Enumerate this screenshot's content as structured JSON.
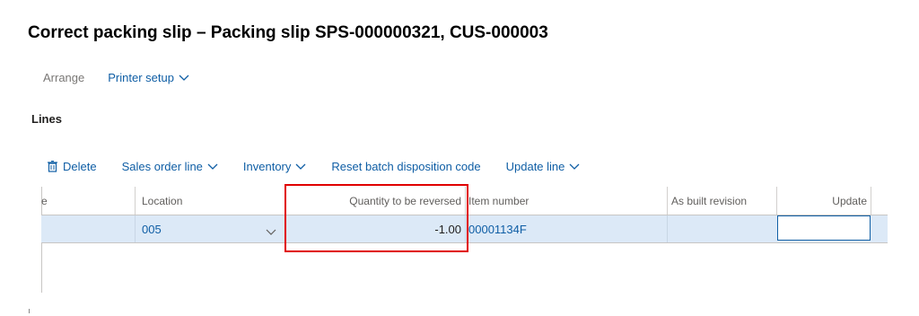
{
  "page": {
    "title": "Correct packing slip – Packing slip SPS-000000321, CUS-000003"
  },
  "toolbar": {
    "arrange_label": "Arrange",
    "printer_setup_label": "Printer setup"
  },
  "lines_section": {
    "label": "Lines"
  },
  "lines_toolbar": {
    "delete_label": "Delete",
    "sales_order_line_label": "Sales order line",
    "inventory_label": "Inventory",
    "reset_batch_label": "Reset batch disposition code",
    "update_line_label": "Update line"
  },
  "grid": {
    "columns": {
      "first": "e",
      "location": "Location",
      "quantity_to_be_reversed": "Quantity to be reversed",
      "item_number": "Item number",
      "as_built_revision": "As built revision",
      "update": "Update"
    },
    "rows": [
      {
        "location": "005",
        "quantity_to_be_reversed": "-1.00",
        "item_number": "00001134F",
        "as_built_revision": "",
        "update": ""
      }
    ]
  },
  "colors": {
    "accent": "#0f5ea5",
    "selected_row": "#dce9f7",
    "highlight": "#e00000"
  },
  "icons": {
    "delete": "trash-icon",
    "dropdown": "chevron-down-icon"
  }
}
